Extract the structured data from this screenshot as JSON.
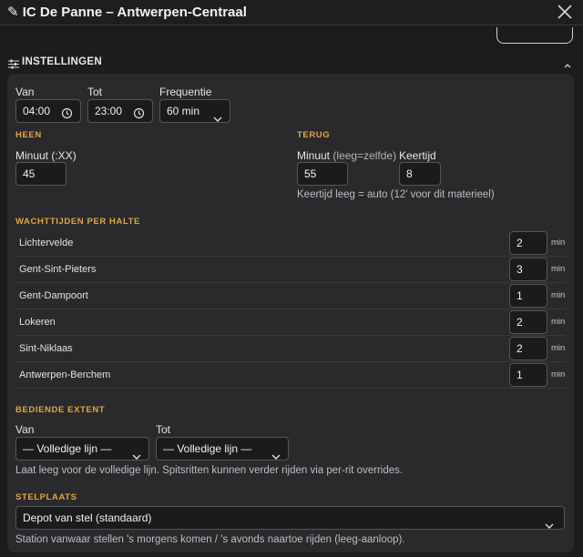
{
  "window": {
    "title": "✎ IC De Panne – Antwerpen-Centraal"
  },
  "settings": {
    "title": "INSTELLINGEN",
    "van_label": "Van",
    "van_value": "04:00",
    "tot_label": "Tot",
    "tot_value": "23:00",
    "freq_label": "Frequentie",
    "freq_value": "60 min",
    "heen": {
      "title": "HEEN",
      "minuut_label": "Minuut (:XX)",
      "minuut_value": "45"
    },
    "terug": {
      "title": "TERUG",
      "minuut_label": "Minuut",
      "minuut_hint": "(leeg=zelfde)",
      "minuut_value": "55",
      "keertijd_label": "Keertijd",
      "keertijd_value": "8",
      "keertijd_note": "Keertijd leeg = auto (12' voor dit materieel)"
    },
    "wachttijden": {
      "title": "WACHTTIJDEN PER HALTE",
      "unit": "min",
      "rows": [
        {
          "name": "Lichtervelde",
          "value": "2"
        },
        {
          "name": "Gent-Sint-Pieters",
          "value": "3"
        },
        {
          "name": "Gent-Dampoort",
          "value": "1"
        },
        {
          "name": "Lokeren",
          "value": "2"
        },
        {
          "name": "Sint-Niklaas",
          "value": "2"
        },
        {
          "name": "Antwerpen-Berchem",
          "value": "1"
        }
      ]
    },
    "extent": {
      "title": "BEDIENDE EXTENT",
      "van_label": "Van",
      "van_value": "— Volledige lijn —",
      "tot_label": "Tot",
      "tot_value": "— Volledige lijn —",
      "note": "Laat leeg voor de volledige lijn. Spitsritten kunnen verder rijden via per-rit overrides."
    },
    "stelplaats": {
      "title": "STELPLAATS",
      "value": "Depot van stel (standaard)",
      "note": "Station vanwaar stellen 's morgens komen / 's avonds naartoe rijden (leeg-aanloop)."
    }
  },
  "colors": {
    "accent": "#e0a73c",
    "panel": "#2a2a2d",
    "background": "#1c1c1e"
  }
}
